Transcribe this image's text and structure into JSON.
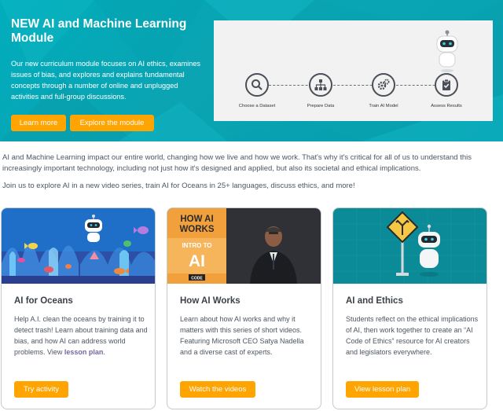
{
  "hero": {
    "title": "NEW AI and Machine Learning Module",
    "description": "Our new curriculum module focuses on AI ethics, examines issues of bias, and explores and explains fundamental concepts through a number of online and unplugged activities and full-group discussions.",
    "learn_more_label": "Learn more",
    "explore_label": "Explore the module",
    "steps": [
      {
        "label": "Choose a Dataset",
        "icon": "search-icon"
      },
      {
        "label": "Prepare Data",
        "icon": "hierarchy-icon"
      },
      {
        "label": "Train AI Model",
        "icon": "gears-icon"
      },
      {
        "label": "Assess Results",
        "icon": "clipboard-check-icon"
      }
    ]
  },
  "intro": {
    "paragraph1": "AI and Machine Learning impact our entire world, changing how we live and how we work. That's why it's critical for all of us to understand this increasingly important technology, including not just how it's designed and applied, but also its societal and ethical implications.",
    "paragraph2": "Join us to explore AI in a new video series, train AI for Oceans in 25+ languages, discuss ethics, and more!"
  },
  "cards": [
    {
      "title": "AI for Oceans",
      "text": "Help A.I. clean the oceans by training it to detect trash! Learn about training data and bias, and how AI can address world problems. View ",
      "link": "lesson plan",
      "text_end": ".",
      "button": "Try activity"
    },
    {
      "title": "How AI Works",
      "text": "Learn about how AI works and why it matters with this series of short videos. Featuring Microsoft CEO Satya Nadella and a diverse cast of experts.",
      "button": "Watch the videos",
      "thumb_line1": "HOW AI",
      "thumb_line2": "WORKS",
      "thumb_line3": "INTRO TO",
      "thumb_line4": "AI",
      "thumb_logo": "CODE"
    },
    {
      "title": "AI and Ethics",
      "text": "Students reflect on the ethical implications of AI, then work together to create an “AI Code of Ethics” resource for AI creators and legislators everywhere.",
      "button": "View lesson plan"
    }
  ],
  "colors": {
    "hero_teal": "#00adbc",
    "accent_orange": "#ffa400",
    "link_purple": "#7665a0",
    "ocean_blue": "#1e6fc9",
    "card2_orange": "#f2a03c",
    "card3_teal": "#0b8a97"
  }
}
